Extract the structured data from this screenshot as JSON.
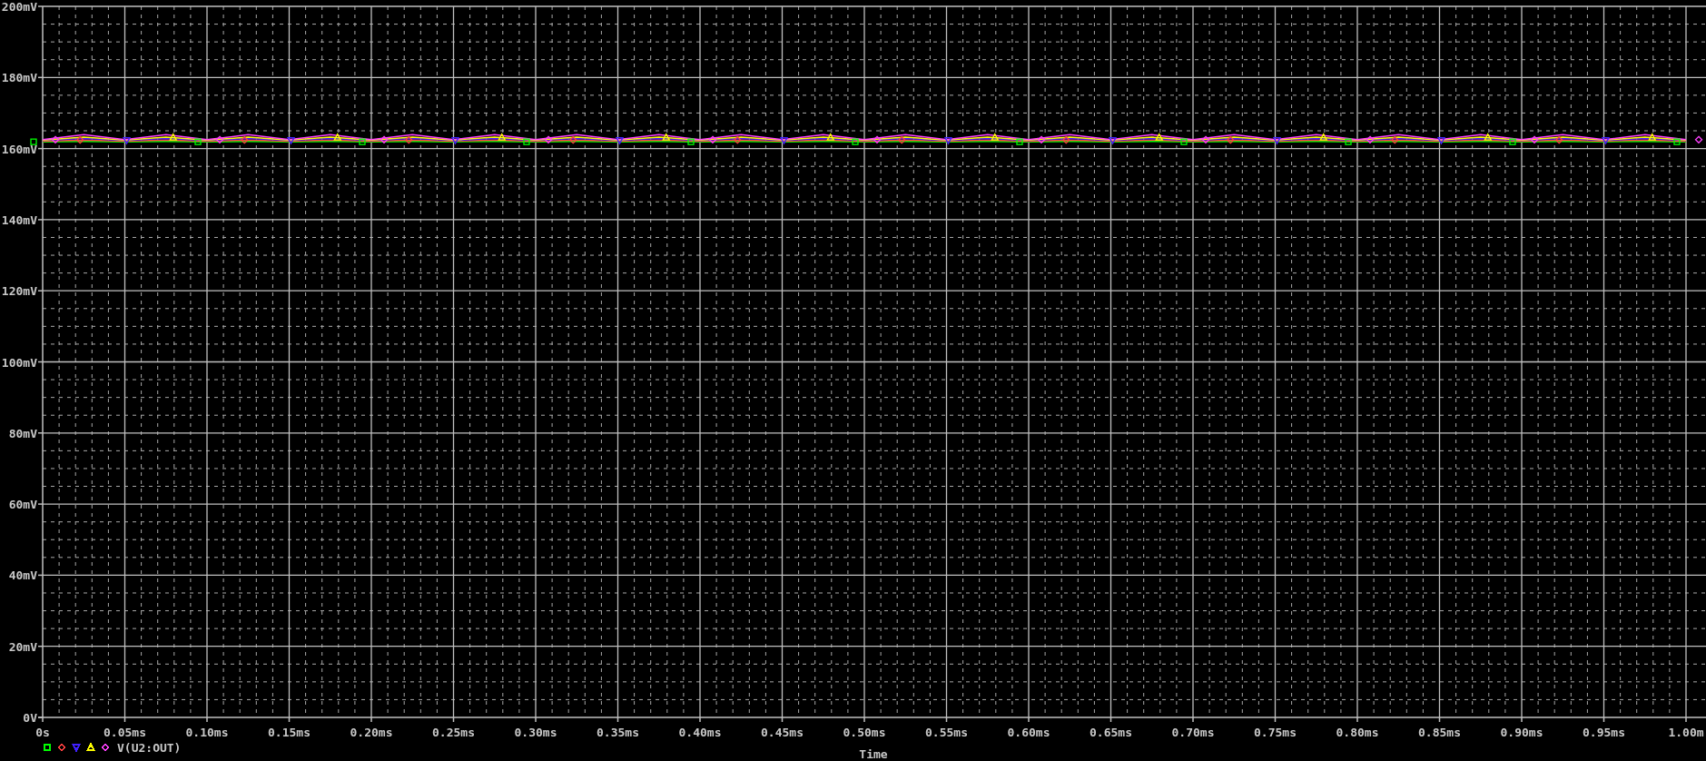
{
  "plot": {
    "legend": {
      "label": "V(U2:OUT)",
      "symbols": [
        {
          "kind": "square",
          "color": "#00ff00"
        },
        {
          "kind": "diamond",
          "color": "#ff4040"
        },
        {
          "kind": "triangle_down",
          "color": "#4020ff"
        },
        {
          "kind": "triangle_up",
          "color": "#ffff00"
        },
        {
          "kind": "diamond",
          "color": "#ff40ff"
        }
      ]
    },
    "chart_data": {
      "type": "line",
      "grid": true,
      "xlabel": "Time",
      "xlim": [
        0,
        1.0
      ],
      "ylim": [
        0,
        200
      ],
      "xticks": [
        {
          "value": 0,
          "label": "0s"
        },
        {
          "value": 0.05,
          "label": "0.05ms"
        },
        {
          "value": 0.1,
          "label": "0.10ms"
        },
        {
          "value": 0.15,
          "label": "0.15ms"
        },
        {
          "value": 0.2,
          "label": "0.20ms"
        },
        {
          "value": 0.25,
          "label": "0.25ms"
        },
        {
          "value": 0.3,
          "label": "0.30ms"
        },
        {
          "value": 0.35,
          "label": "0.35ms"
        },
        {
          "value": 0.4,
          "label": "0.40ms"
        },
        {
          "value": 0.45,
          "label": "0.45ms"
        },
        {
          "value": 0.5,
          "label": "0.50ms"
        },
        {
          "value": 0.55,
          "label": "0.55ms"
        },
        {
          "value": 0.6,
          "label": "0.60ms"
        },
        {
          "value": 0.65,
          "label": "0.65ms"
        },
        {
          "value": 0.7,
          "label": "0.70ms"
        },
        {
          "value": 0.75,
          "label": "0.75ms"
        },
        {
          "value": 0.8,
          "label": "0.80ms"
        },
        {
          "value": 0.85,
          "label": "0.85ms"
        },
        {
          "value": 0.9,
          "label": "0.90ms"
        },
        {
          "value": 0.95,
          "label": "0.95ms"
        },
        {
          "value": 1.0,
          "label": "1.00m"
        }
      ],
      "yticks": [
        {
          "value": 0,
          "label": "0V"
        },
        {
          "value": 20,
          "label": "20mV"
        },
        {
          "value": 40,
          "label": "40mV"
        },
        {
          "value": 60,
          "label": "60mV"
        },
        {
          "value": 80,
          "label": "80mV"
        },
        {
          "value": 100,
          "label": "100mV"
        },
        {
          "value": 120,
          "label": "120mV"
        },
        {
          "value": 140,
          "label": "140mV"
        },
        {
          "value": 160,
          "label": "160mV"
        },
        {
          "value": 180,
          "label": "180mV"
        },
        {
          "value": 200,
          "label": "200mV"
        }
      ],
      "x": [
        0,
        0.025,
        0.05,
        0.075,
        0.1,
        0.125,
        0.15,
        0.175,
        0.2,
        0.225,
        0.25,
        0.275,
        0.3,
        0.325,
        0.35,
        0.375,
        0.4,
        0.425,
        0.45,
        0.475,
        0.5,
        0.525,
        0.55,
        0.575,
        0.6,
        0.625,
        0.65,
        0.675,
        0.7,
        0.725,
        0.75,
        0.775,
        0.8,
        0.825,
        0.85,
        0.875,
        0.9,
        0.925,
        0.95,
        0.975,
        1.0
      ],
      "series": [
        {
          "color": "#00ff00",
          "values": [
            161.9,
            162.0,
            161.9,
            162.0,
            161.9,
            162.0,
            161.9,
            162.0,
            161.9,
            162.0,
            161.9,
            162.0,
            161.9,
            162.0,
            161.9,
            162.0,
            161.9,
            162.0,
            161.9,
            162.0,
            161.9,
            162.0,
            161.9,
            162.0,
            161.9,
            162.0,
            161.9,
            162.0,
            161.9,
            162.0,
            161.9,
            162.0,
            161.9,
            162.0,
            161.9,
            162.0,
            161.9,
            162.0,
            161.9,
            162.0,
            161.9
          ]
        },
        {
          "color": "#ff4040",
          "values": [
            162.1,
            162.4,
            162.1,
            162.4,
            162.1,
            162.4,
            162.1,
            162.4,
            162.1,
            162.4,
            162.1,
            162.4,
            162.1,
            162.4,
            162.1,
            162.4,
            162.1,
            162.4,
            162.1,
            162.4,
            162.1,
            162.4,
            162.1,
            162.4,
            162.1,
            162.4,
            162.1,
            162.4,
            162.1,
            162.4,
            162.1,
            162.4,
            162.1,
            162.4,
            162.1,
            162.4,
            162.1,
            162.4,
            162.1,
            162.4,
            162.1
          ]
        },
        {
          "color": "#4020ff",
          "values": [
            162.3,
            162.8,
            162.3,
            162.8,
            162.3,
            162.8,
            162.3,
            162.8,
            162.3,
            162.8,
            162.3,
            162.8,
            162.3,
            162.8,
            162.3,
            162.8,
            162.3,
            162.8,
            162.3,
            162.8,
            162.3,
            162.8,
            162.3,
            162.8,
            162.3,
            162.8,
            162.3,
            162.8,
            162.3,
            162.8,
            162.3,
            162.8,
            162.3,
            162.8,
            162.3,
            162.8,
            162.3,
            162.8,
            162.3,
            162.8,
            162.3
          ]
        },
        {
          "color": "#ffff00",
          "values": [
            162.4,
            163.2,
            162.4,
            163.2,
            162.4,
            163.2,
            162.4,
            163.2,
            162.4,
            163.2,
            162.4,
            163.2,
            162.4,
            163.2,
            162.4,
            163.2,
            162.4,
            163.2,
            162.4,
            163.2,
            162.4,
            163.2,
            162.4,
            163.2,
            162.4,
            163.2,
            162.4,
            163.2,
            162.4,
            163.2,
            162.4,
            163.2,
            162.4,
            163.2,
            162.4,
            163.2,
            162.4,
            163.2,
            162.4,
            163.2,
            162.4
          ]
        },
        {
          "color": "#ff40ff",
          "values": [
            162.5,
            163.9,
            162.5,
            163.9,
            162.5,
            163.9,
            162.5,
            163.9,
            162.5,
            163.9,
            162.5,
            163.9,
            162.5,
            163.9,
            162.5,
            163.9,
            162.5,
            163.9,
            162.5,
            163.9,
            162.5,
            163.9,
            162.5,
            163.9,
            162.5,
            163.9,
            162.5,
            163.9,
            162.5,
            163.9,
            162.5,
            163.9,
            162.5,
            163.9,
            162.5,
            163.9,
            162.5,
            163.9,
            162.5,
            163.9,
            162.5
          ]
        }
      ]
    }
  }
}
